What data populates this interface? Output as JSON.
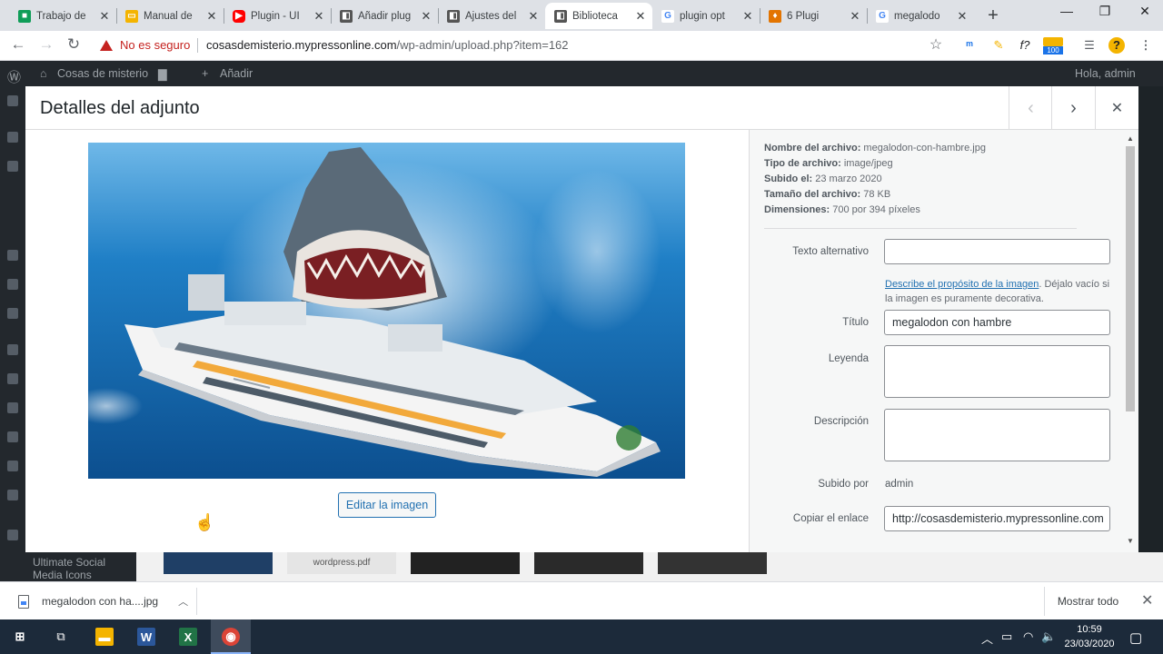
{
  "browser": {
    "tabs": [
      {
        "title": "Trabajo de",
        "icon": "classroom-icon",
        "color": "#0f9d58"
      },
      {
        "title": "Manual de",
        "icon": "slides-icon",
        "color": "#f4b400"
      },
      {
        "title": "Plugin - UI",
        "icon": "youtube-icon",
        "color": "#ff0000"
      },
      {
        "title": "Añadir plug",
        "icon": "site-icon",
        "color": "#555555"
      },
      {
        "title": "Ajustes del",
        "icon": "site-icon",
        "color": "#555555"
      },
      {
        "title": "Biblioteca",
        "icon": "site-icon",
        "color": "#555555"
      },
      {
        "title": "plugin opt",
        "icon": "google-icon",
        "color": "#4285f4"
      },
      {
        "title": "6 Plugi",
        "icon": "page-icon",
        "color": "#e37400"
      },
      {
        "title": "megalodo",
        "icon": "google-icon",
        "color": "#4285f4"
      }
    ],
    "new_tab": "+",
    "security_text": "No es seguro",
    "url_host": "cosasdemisterio.mypressonline.com",
    "url_path": "/wp-admin/upload.php?item=162",
    "extension_badge": "100"
  },
  "adminbar": {
    "site_name": "Cosas de misterio",
    "new_label": "Añadir",
    "greeting": "Hola, admin"
  },
  "background": {
    "sidebar_text": "Ultimate Social Media Icons",
    "thumb_label": "wordpress.pdf"
  },
  "modal": {
    "title": "Detalles del adjunto",
    "edit_image_label": "Editar la imagen",
    "meta": {
      "filename_label": "Nombre del archivo:",
      "filename": "megalodon-con-hambre.jpg",
      "type_label": "Tipo de archivo:",
      "type": "image/jpeg",
      "uploaded_label": "Subido el:",
      "uploaded": "23 marzo 2020",
      "size_label": "Tamaño del archivo:",
      "size": "78 KB",
      "dimensions_label": "Dimensiones:",
      "dimensions": "700 por 394 píxeles"
    },
    "fields": {
      "alt_label": "Texto alternativo",
      "alt_value": "",
      "alt_help_link": "Describe el propósito de la imagen",
      "alt_help_rest": ". Déjalo vacío si la imagen es puramente decorativa.",
      "title_label": "Título",
      "title_value": "megalodon con hambre",
      "caption_label": "Leyenda",
      "caption_value": "",
      "description_label": "Descripción",
      "description_value": "",
      "uploaded_by_label": "Subido por",
      "uploaded_by": "admin",
      "copy_link_label": "Copiar el enlace",
      "copy_link_value": "http://cosasdemisterio.mypressonline.com"
    }
  },
  "downloads": {
    "file": "megalodon con ha....jpg",
    "show_all": "Mostrar todo"
  },
  "taskbar": {
    "time": "10:59",
    "date": "23/03/2020"
  }
}
